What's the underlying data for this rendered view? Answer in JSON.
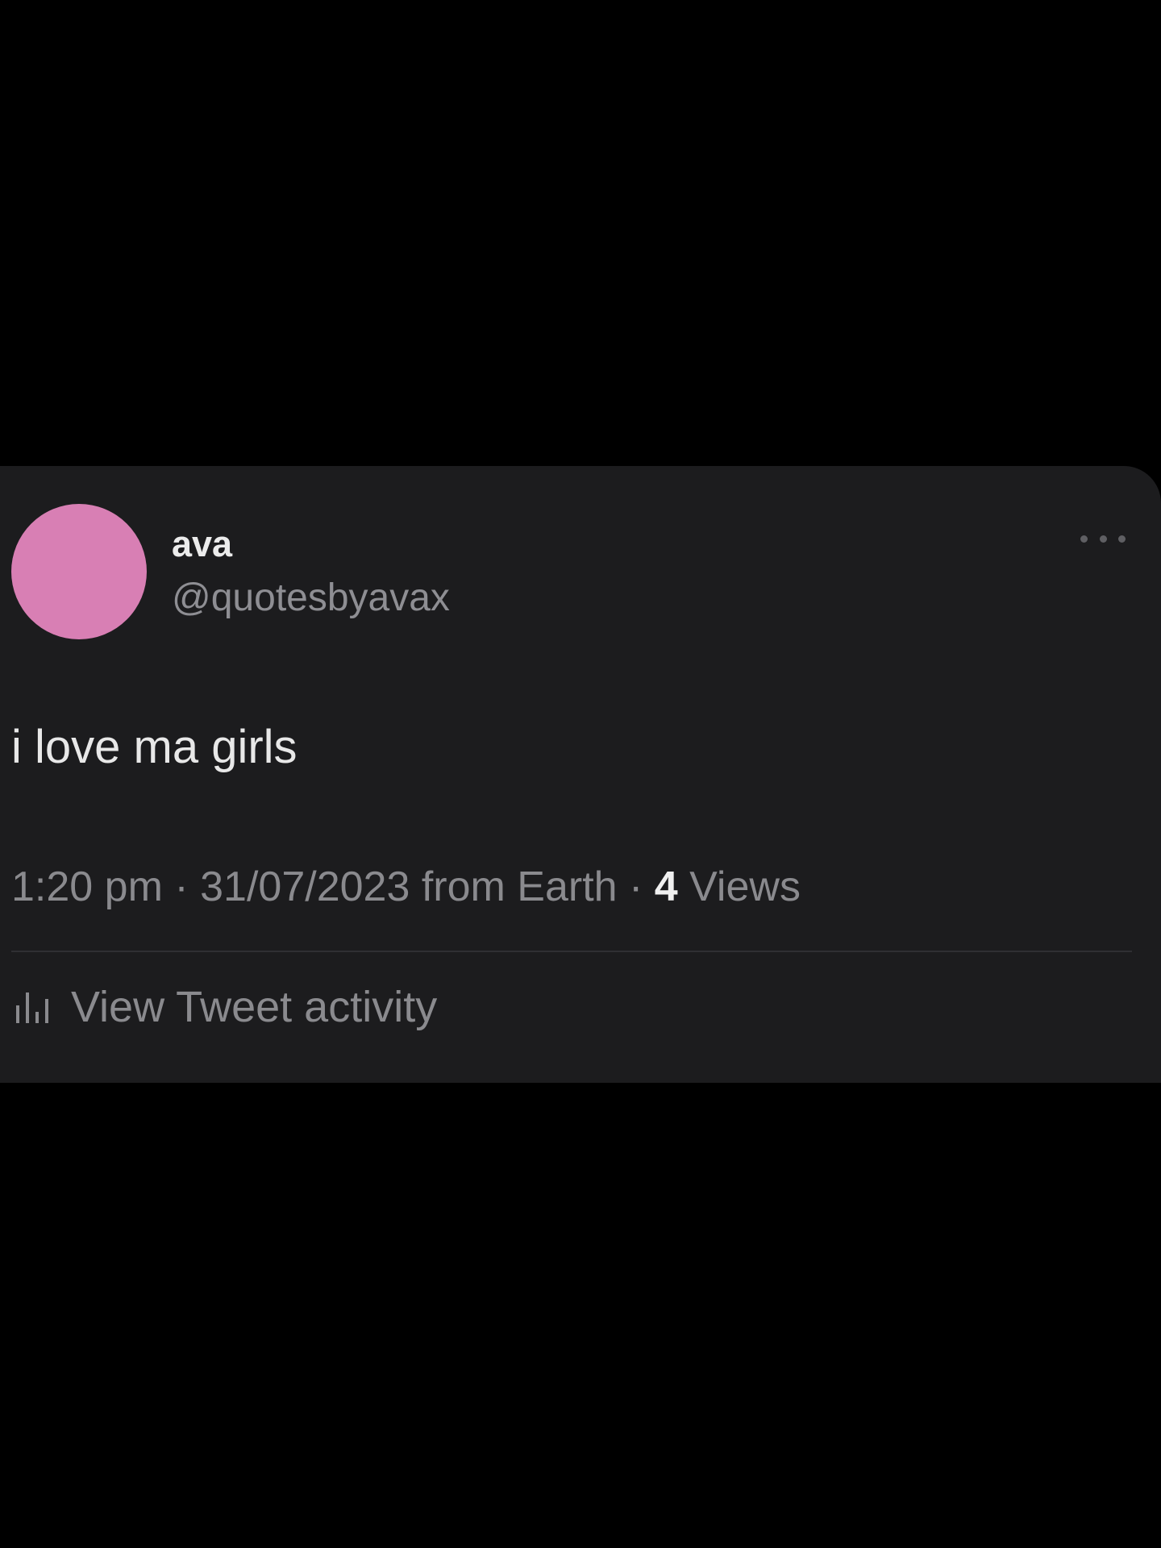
{
  "tweet": {
    "author": {
      "display_name": "ava",
      "handle": "@quotesbyavax",
      "avatar_color": "#d87fb4"
    },
    "more_icon": "more-horizontal-icon",
    "text": "i love ma girls",
    "time": "1:20 pm",
    "separator": "·",
    "date_source": "31/07/2023 from Earth",
    "views_count": "4",
    "views_label": "Views",
    "activity": {
      "icon": "bar-chart-icon",
      "label": "View Tweet activity"
    }
  },
  "colors": {
    "background": "#000000",
    "card": "#1c1c1e",
    "text_primary": "#e8e8e8",
    "text_secondary": "#8a8a8e"
  }
}
